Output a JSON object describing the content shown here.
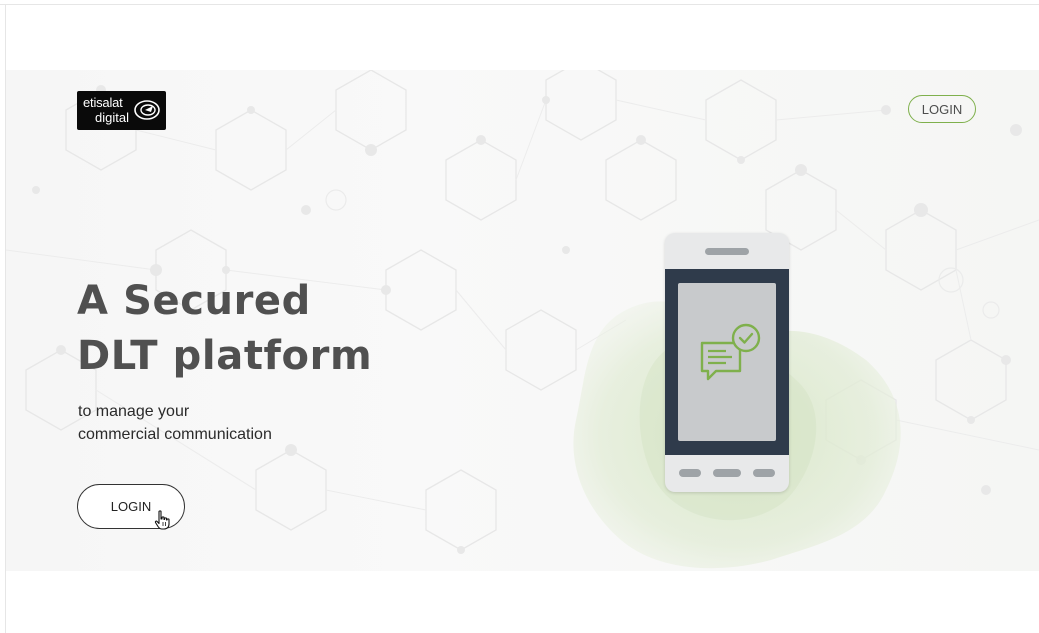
{
  "brand": {
    "name_line1": "etisalat",
    "name_line2": "digital",
    "logo_icon": "etisalat-swirl-icon"
  },
  "header": {
    "login_label": "LOGIN"
  },
  "hero": {
    "headline_line1": "A Secured",
    "headline_line2": "DLT platform",
    "subtitle_line1": "to manage your",
    "subtitle_line2": "commercial communication",
    "login_label": "LOGIN"
  },
  "illustration": {
    "device": "smartphone-icon",
    "message_icon": "chat-check-icon",
    "cursor": "hand-pointer-icon"
  },
  "colors": {
    "accent_green": "#7fb04c",
    "phone_frame": "#2f3b4b",
    "heading": "#505050",
    "logo_bg": "#0a0a0a"
  }
}
